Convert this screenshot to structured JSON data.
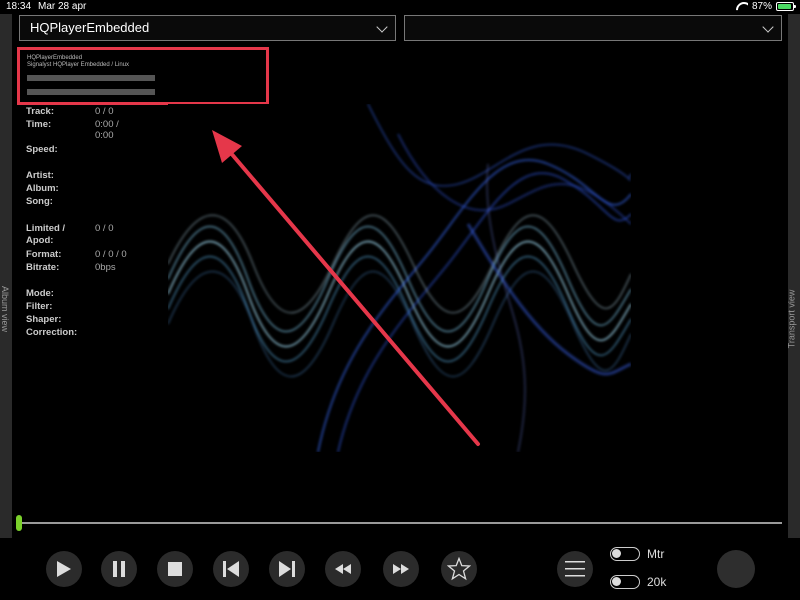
{
  "status_bar": {
    "time": "18:34",
    "date": "Mar 28 apr",
    "battery": "87%",
    "battery_level": 0.87
  },
  "rails": {
    "left_label": "Album view",
    "right_label": "Transport view"
  },
  "selectors": {
    "player": "HQPlayerEmbedded",
    "secondary": ""
  },
  "infobox": {
    "line1": "HQPlayerEmbedded",
    "line2": "Signalyst HQPlayer Embedded / Linux"
  },
  "info": {
    "track_label": "Track:",
    "track_value": "0 / 0",
    "time_label": "Time:",
    "time_value_1": "0:00 /",
    "time_value_2": "0:00",
    "speed_label": "Speed:",
    "artist_label": "Artist:",
    "album_label": "Album:",
    "song_label": "Song:",
    "limited_label": "Limited /",
    "apod_label": "Apod:",
    "limited_value": "0 / 0",
    "format_label": "Format:",
    "format_value": "0 / 0 / 0",
    "bitrate_label": "Bitrate:",
    "bitrate_value": "0bps",
    "mode_label": "Mode:",
    "filter_label": "Filter:",
    "shaper_label": "Shaper:",
    "correction_label": "Correction:"
  },
  "progress": {
    "position": 0.0
  },
  "controls": {
    "toggle1_label": "Mtr",
    "toggle2_label": "20k"
  },
  "colors": {
    "accent_red": "#e5374a",
    "progress_green": "#7bd12b",
    "wave_blue": "#3b6dff",
    "wave_cyan": "#9fd8f0"
  }
}
